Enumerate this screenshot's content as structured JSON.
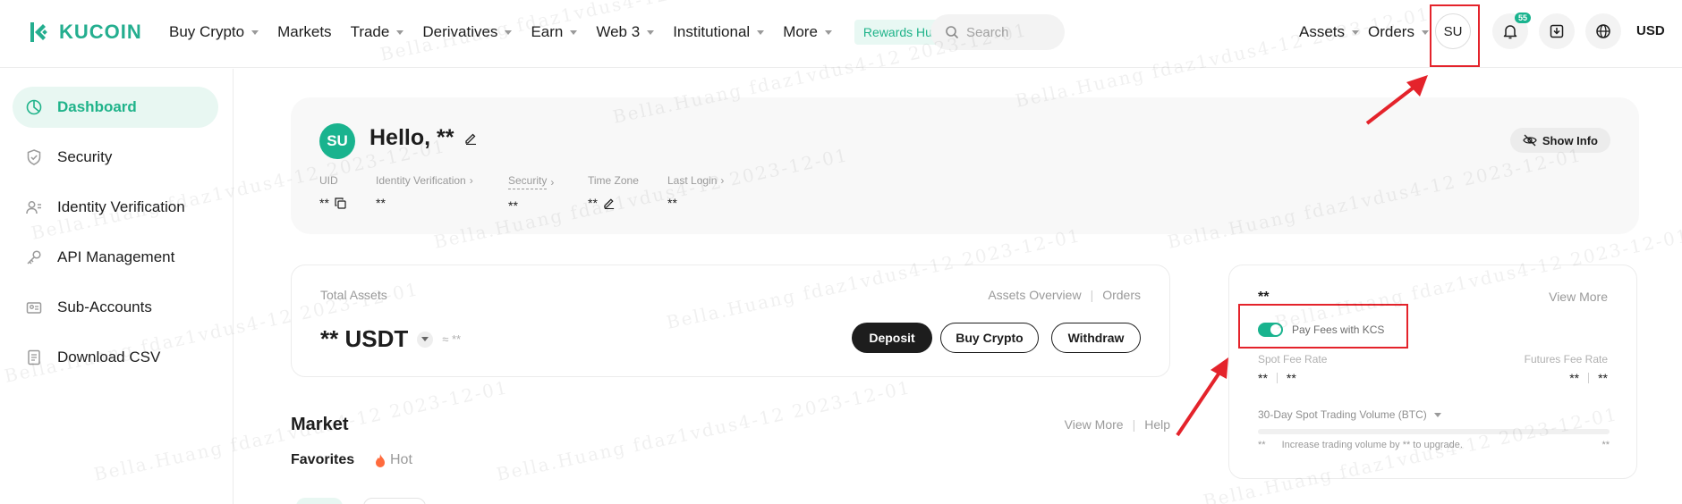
{
  "brand": {
    "name": "KUCOIN",
    "accent": "#24ae8f"
  },
  "nav": {
    "items": [
      {
        "label": "Buy Crypto",
        "caret": true
      },
      {
        "label": "Markets",
        "caret": false
      },
      {
        "label": "Trade",
        "caret": true
      },
      {
        "label": "Derivatives",
        "caret": true
      },
      {
        "label": "Earn",
        "caret": true
      },
      {
        "label": "Web 3",
        "caret": true
      },
      {
        "label": "Institutional",
        "caret": true
      },
      {
        "label": "More",
        "caret": true
      }
    ],
    "rewards_label": "Rewards Hub",
    "search_placeholder": "Search",
    "assets_label": "Assets",
    "orders_label": "Orders",
    "avatar_initials": "SU",
    "notifications_count": "55",
    "currency": "USD"
  },
  "sidebar": {
    "items": [
      {
        "label": "Dashboard",
        "icon": "pie-chart-icon",
        "active": true
      },
      {
        "label": "Security",
        "icon": "shield-icon",
        "active": false
      },
      {
        "label": "Identity Verification",
        "icon": "user-id-icon",
        "active": false
      },
      {
        "label": "API Management",
        "icon": "api-key-icon",
        "active": false
      },
      {
        "label": "Sub-Accounts",
        "icon": "sub-accounts-icon",
        "active": false
      },
      {
        "label": "Download CSV",
        "icon": "download-csv-icon",
        "active": false
      }
    ]
  },
  "profile": {
    "avatar_initials": "SU",
    "greeting": "Hello, **",
    "show_info_label": "Show Info",
    "meta": [
      {
        "label": "UID",
        "value": "**"
      },
      {
        "label": "Identity Verification",
        "value": "**"
      },
      {
        "label": "Security",
        "value": "**"
      },
      {
        "label": "Time Zone",
        "value": "**"
      },
      {
        "label": "Last Login",
        "value": "**"
      }
    ]
  },
  "assets": {
    "total_label": "Total Assets",
    "overview_link": "Assets Overview",
    "orders_link": "Orders",
    "amount": "** USDT",
    "approx": "≈ **",
    "deposit_label": "Deposit",
    "buy_label": "Buy Crypto",
    "withdraw_label": "Withdraw"
  },
  "market": {
    "title": "Market",
    "view_more": "View More",
    "help": "Help",
    "tabs": [
      "Favorites",
      "Hot"
    ]
  },
  "fees": {
    "level": "**",
    "view_more": "View More",
    "toggle_label": "Pay Fees with KCS",
    "toggle_on": true,
    "spot_label": "Spot Fee Rate",
    "spot_maker": "**",
    "spot_taker": "**",
    "futures_label": "Futures Fee Rate",
    "futures_maker": "**",
    "futures_taker": "**",
    "volume_label": "30-Day Spot Trading Volume (BTC)",
    "vol_left": "**",
    "vol_message": "Increase trading volume by ** to upgrade.",
    "vol_right": "**"
  },
  "watermark_text": "Bella.Huang fdaz1vdus4-12 2023-12-01",
  "annotation_color": "#e4232b"
}
